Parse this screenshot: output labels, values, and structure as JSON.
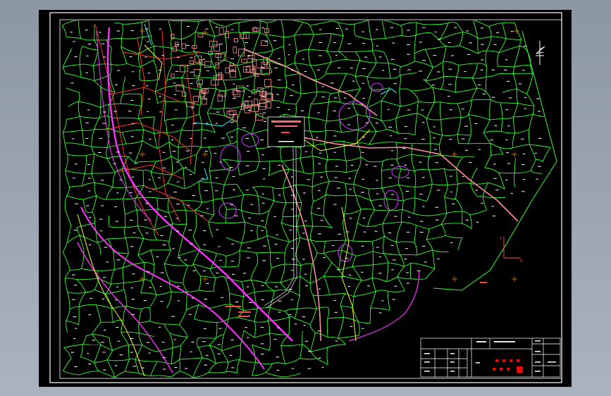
{
  "colors": {
    "background_outer": "#9aa4b1",
    "sheet": "#000000",
    "frame": "#ffffff",
    "parcels": "#33ff33",
    "settlement": "#ff9999",
    "roads": "#ff3333",
    "river": "#ff33ff",
    "ponds": "#cc33ff",
    "tracks": "#ffff33",
    "labels": "#ffffff",
    "grid_marks": "#ff8800",
    "title_block_red": "#ff0000"
  },
  "icons": {
    "north_arrow": "north-arrow-icon",
    "axis_marker": "xy-axis-icon"
  },
  "axis_marker": {
    "x_label": "X",
    "y_label": "Y"
  }
}
